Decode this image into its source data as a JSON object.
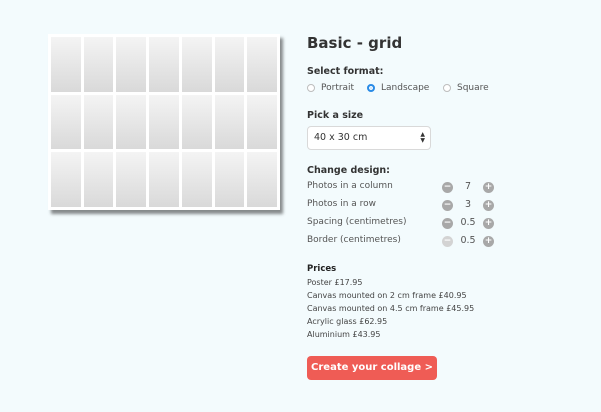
{
  "preview": {
    "columns": 7,
    "rows": 3
  },
  "panel": {
    "title": "Basic - grid",
    "format": {
      "label": "Select format:",
      "options": [
        {
          "label": "Portrait",
          "selected": false
        },
        {
          "label": "Landscape",
          "selected": true
        },
        {
          "label": "Square",
          "selected": false
        }
      ]
    },
    "size": {
      "label": "Pick a size",
      "value": "40 x 30 cm"
    },
    "design": {
      "label": "Change design:",
      "controls": [
        {
          "label": "Photos in a column",
          "value": "7"
        },
        {
          "label": "Photos in a row",
          "value": "3"
        },
        {
          "label": "Spacing (centimetres)",
          "value": "0.5"
        },
        {
          "label": "Border (centimetres)",
          "value": "0.5"
        }
      ]
    },
    "prices": {
      "title": "Prices",
      "items": [
        "Poster £17.95",
        "Canvas mounted on 2 cm frame £40.95",
        "Canvas mounted on 4.5 cm frame £45.95",
        "Acrylic glass £62.95",
        "Aluminium £43.95"
      ]
    },
    "cta_label": "Create your collage >"
  },
  "colors": {
    "accent": "#ef5c55",
    "radio_selected": "#2a8be6",
    "background": "#f3fbfd"
  }
}
